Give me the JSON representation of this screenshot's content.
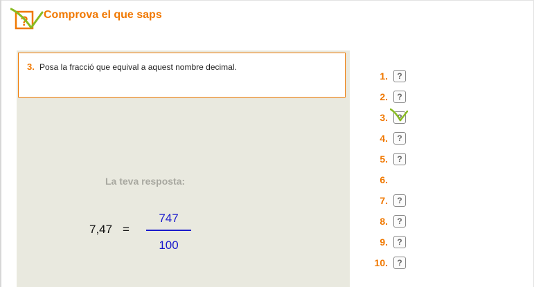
{
  "header": {
    "title": "Comprova el que saps",
    "logo_icon": "question-check-logo-icon"
  },
  "question": {
    "number": "3.",
    "text": "Posa la fracció que equival a aquest nombre decimal."
  },
  "answer": {
    "label": "La teva resposta:",
    "decimal": "7,47",
    "equals": "=",
    "numerator": "747",
    "denominator": "100"
  },
  "nav": {
    "items": [
      {
        "label": "1.",
        "status": "unanswered",
        "symbol": "?"
      },
      {
        "label": "2.",
        "status": "unanswered",
        "symbol": "?"
      },
      {
        "label": "3.",
        "status": "correct",
        "symbol": "?"
      },
      {
        "label": "4.",
        "status": "unanswered",
        "symbol": "?"
      },
      {
        "label": "5.",
        "status": "unanswered",
        "symbol": "?"
      },
      {
        "label": "6.",
        "status": "current",
        "symbol": ""
      },
      {
        "label": "7.",
        "status": "unanswered",
        "symbol": "?"
      },
      {
        "label": "8.",
        "status": "unanswered",
        "symbol": "?"
      },
      {
        "label": "9.",
        "status": "unanswered",
        "symbol": "?"
      },
      {
        "label": "10.",
        "status": "unanswered",
        "symbol": "?"
      }
    ]
  },
  "colors": {
    "accent": "#f07800",
    "answer_blue": "#1a1acc",
    "panel_bg": "#e9e9df",
    "check_green": "#88bb22"
  }
}
